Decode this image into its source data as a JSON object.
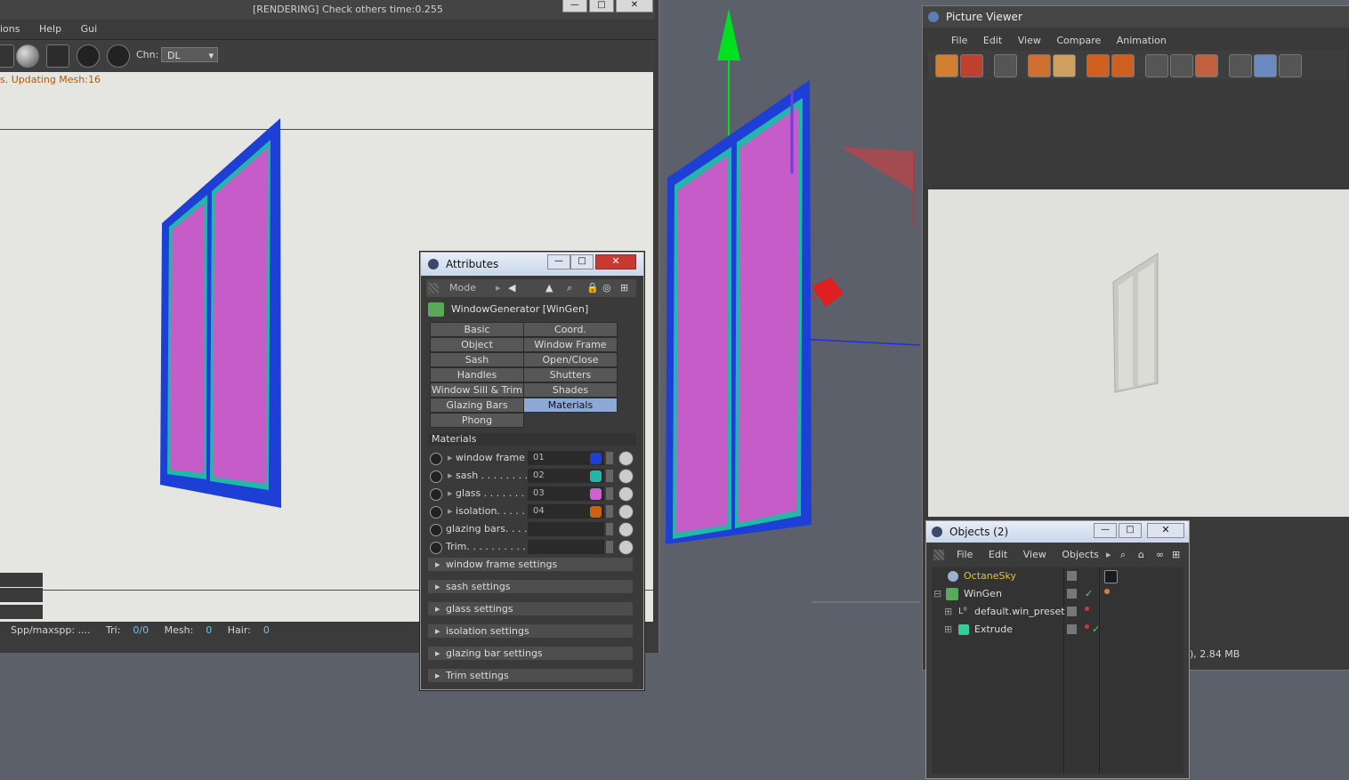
{
  "live_viewer": {
    "menu": [
      "ions",
      "Help",
      "Gui"
    ],
    "title": "[RENDERING] Check others time:0.255",
    "channel_label": "Chn:",
    "channel_value": "DL",
    "log_text": "s. Updating Mesh:16",
    "status": {
      "spp": "Spp/maxspp: ....",
      "tri_label": "Tri:",
      "tri_value": "0/0",
      "mesh_label": "Mesh:",
      "mesh_value": "0",
      "hair_label": "Hair:",
      "hair_value": "0"
    }
  },
  "picture_viewer": {
    "title": "Picture Viewer",
    "menu": [
      "File",
      "Edit",
      "View",
      "Compare",
      "Animation"
    ],
    "status": "), 2.84 MB"
  },
  "attributes": {
    "title": "Attributes",
    "mode_label": "Mode",
    "object_name": "WindowGenerator [WinGen]",
    "tabs": [
      {
        "label": "Basic",
        "selected": false
      },
      {
        "label": "Coord.",
        "selected": false
      },
      {
        "label": "Object",
        "selected": false
      },
      {
        "label": "Window Frame",
        "selected": false
      },
      {
        "label": "Sash",
        "selected": false
      },
      {
        "label": "Open/Close",
        "selected": false
      },
      {
        "label": "Handles",
        "selected": false
      },
      {
        "label": "Shutters",
        "selected": false
      },
      {
        "label": "Window Sill & Trim",
        "selected": false
      },
      {
        "label": "Shades",
        "selected": false
      },
      {
        "label": "Glazing Bars",
        "selected": false
      },
      {
        "label": "Materials",
        "selected": true
      },
      {
        "label": "Phong",
        "selected": false
      }
    ],
    "section_title": "Materials",
    "materials": [
      {
        "label": "window frame",
        "value": "01",
        "color": "#1e3fd6"
      },
      {
        "label": "sash . . . . . . . .",
        "value": "02",
        "color": "#22b8a8"
      },
      {
        "label": "glass . . . . . . . .",
        "value": "03",
        "color": "#d060d0"
      },
      {
        "label": "isolation. . . . .",
        "value": "04",
        "color": "#d06010"
      },
      {
        "label": "glazing bars. . . .",
        "value": "",
        "color": ""
      },
      {
        "label": "Trim. . . . . . . . . .",
        "value": "",
        "color": ""
      }
    ],
    "fold_sections": [
      "window frame settings",
      "sash settings",
      "glass settings",
      "isolation settings",
      "glazing bar settings",
      "Trim settings"
    ]
  },
  "objects": {
    "title": "Objects (2)",
    "menu": [
      "File",
      "Edit",
      "View",
      "Objects"
    ],
    "rows": [
      {
        "name": "OctaneSky",
        "color": "#e0c040"
      },
      {
        "name": "WinGen",
        "color": "#dcdcdc"
      },
      {
        "name": "default.win_preset",
        "color": "#dcdcdc"
      },
      {
        "name": "Extrude",
        "color": "#dcdcdc"
      }
    ]
  },
  "colors": {
    "frame_blue": "#1e3fd6",
    "glass_magenta": "#c65cc8",
    "sash_teal": "#22b8a8",
    "selection_blue": "#8fa9d6"
  }
}
